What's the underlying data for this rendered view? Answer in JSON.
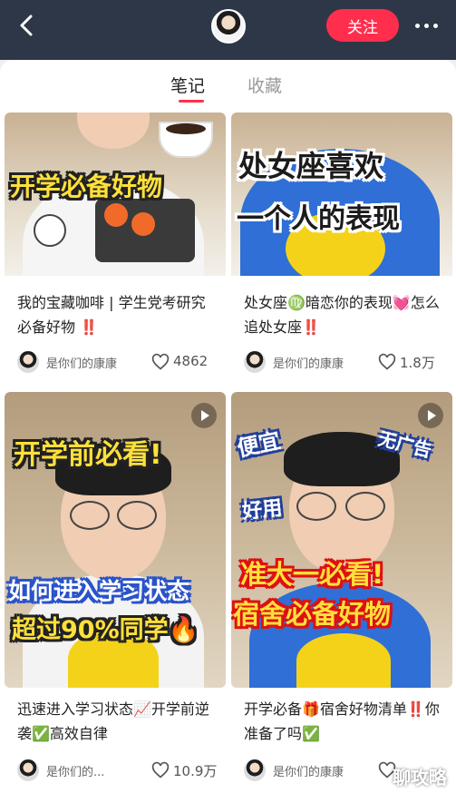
{
  "header": {
    "follow_label": "关注",
    "accent_color": "#ff2e4d"
  },
  "tabs": [
    {
      "label": "笔记",
      "active": true
    },
    {
      "label": "收藏",
      "active": false
    }
  ],
  "notes": [
    {
      "cover_text": [
        "开学必备好物"
      ],
      "title": "我的宝藏咖啡 | 学生党考研究必备好物 ‼️",
      "author": "是你们的康康",
      "likes": "4862",
      "video": false
    },
    {
      "cover_text": [
        "处女座喜欢",
        "一个人的表现"
      ],
      "title": "处女座♍️暗恋你的表现💓怎么追处女座‼️",
      "author": "是你们的康康",
      "likes": "1.8万",
      "video": false
    },
    {
      "cover_text": [
        "开学前必看!",
        "如何进入学习状态",
        "超过90%同学🔥"
      ],
      "title": "迅速进入学习状态📈开学前逆袭✅高效自律",
      "author": "是你们的...",
      "likes": "10.9万",
      "video": true
    },
    {
      "cover_text": [
        "便宜",
        "无广告",
        "好用",
        "准大一必看!",
        "宿舍必备好物"
      ],
      "title": "开学必备🎁宿舍好物清单‼️你准备了吗✅",
      "author": "是你们的康康",
      "likes": "",
      "video": true
    }
  ],
  "watermark": "聊攻略"
}
